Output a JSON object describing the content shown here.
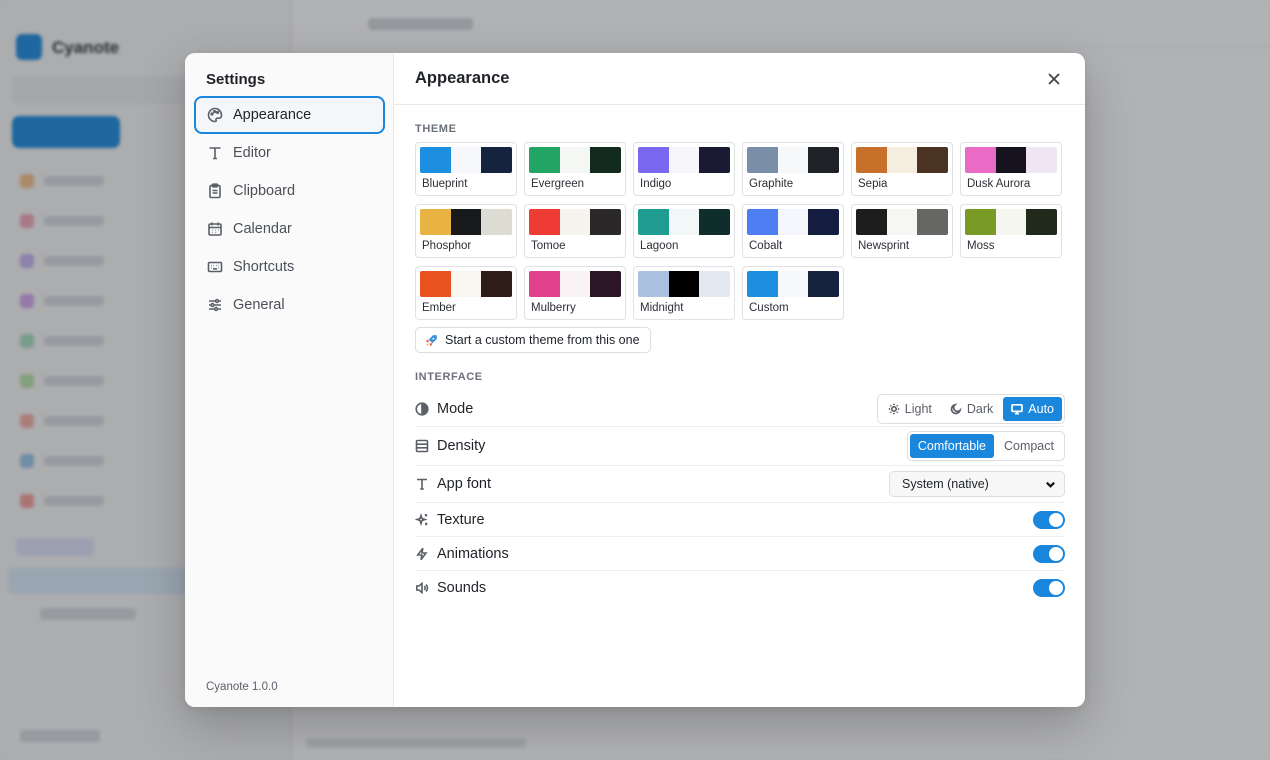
{
  "background": {
    "brand": "Cyanote"
  },
  "settings": {
    "title": "Settings",
    "version": "Cyanote 1.0.0",
    "nav": [
      {
        "label": "Appearance",
        "icon": "palette-icon",
        "active": true
      },
      {
        "label": "Editor",
        "icon": "type-icon",
        "active": false
      },
      {
        "label": "Clipboard",
        "icon": "clipboard-icon",
        "active": false
      },
      {
        "label": "Calendar",
        "icon": "calendar-icon",
        "active": false
      },
      {
        "label": "Shortcuts",
        "icon": "keyboard-icon",
        "active": false
      },
      {
        "label": "General",
        "icon": "sliders-icon",
        "active": false
      }
    ]
  },
  "appearance": {
    "title": "Appearance",
    "theme_label": "THEME",
    "themes": [
      {
        "name": "Blueprint",
        "colors": [
          "#1e8fe0",
          "#f6f8fb",
          "#15233f"
        ]
      },
      {
        "name": "Evergreen",
        "colors": [
          "#22a565",
          "#f4f7f4",
          "#132a1f"
        ]
      },
      {
        "name": "Indigo",
        "colors": [
          "#7b68f0",
          "#f6f6fb",
          "#1b1a33"
        ]
      },
      {
        "name": "Graphite",
        "colors": [
          "#7a8ea8",
          "#f7f8fa",
          "#1e2126"
        ]
      },
      {
        "name": "Sepia",
        "colors": [
          "#c7702a",
          "#f4ede0",
          "#4a3322"
        ]
      },
      {
        "name": "Dusk Aurora",
        "colors": [
          "#ea6bc6",
          "#16131f",
          "#efe6f4"
        ]
      },
      {
        "name": "Phosphor",
        "colors": [
          "#e8b341",
          "#17191a",
          "#dcdcd2"
        ]
      },
      {
        "name": "Tomoe",
        "colors": [
          "#ee3b34",
          "#f6f4ef",
          "#2a2828"
        ]
      },
      {
        "name": "Lagoon",
        "colors": [
          "#1f9d93",
          "#f2f8f7",
          "#0f2d2b"
        ]
      },
      {
        "name": "Cobalt",
        "colors": [
          "#4f7ef2",
          "#f5f7fc",
          "#141c3f"
        ]
      },
      {
        "name": "Newsprint",
        "colors": [
          "#1d1d1d",
          "#f6f6f2",
          "#666662"
        ]
      },
      {
        "name": "Moss",
        "colors": [
          "#7a9a26",
          "#f5f6f0",
          "#20291a"
        ]
      },
      {
        "name": "Ember",
        "colors": [
          "#e8521f",
          "#f9f5f0",
          "#2d1d16"
        ]
      },
      {
        "name": "Mulberry",
        "colors": [
          "#e0418a",
          "#f9f3f6",
          "#2b1628"
        ]
      },
      {
        "name": "Midnight",
        "colors": [
          "#a9c1de",
          "#000000",
          "#e4e8f0"
        ]
      },
      {
        "name": "Custom",
        "colors": [
          "#1e8fe0",
          "#f6f8fb",
          "#15233f"
        ]
      }
    ],
    "custom_button": "Start a custom theme from this one",
    "interface_label": "INTERFACE",
    "mode": {
      "label": "Mode",
      "options": [
        "Light",
        "Dark",
        "Auto"
      ],
      "selected": "Auto"
    },
    "density": {
      "label": "Density",
      "options": [
        "Comfortable",
        "Compact"
      ],
      "selected": "Comfortable"
    },
    "app_font": {
      "label": "App font",
      "value": "System (native)"
    },
    "texture": {
      "label": "Texture",
      "on": true
    },
    "animations": {
      "label": "Animations",
      "on": true
    },
    "sounds": {
      "label": "Sounds",
      "on": true
    },
    "accent_color": "#1a86dc"
  }
}
